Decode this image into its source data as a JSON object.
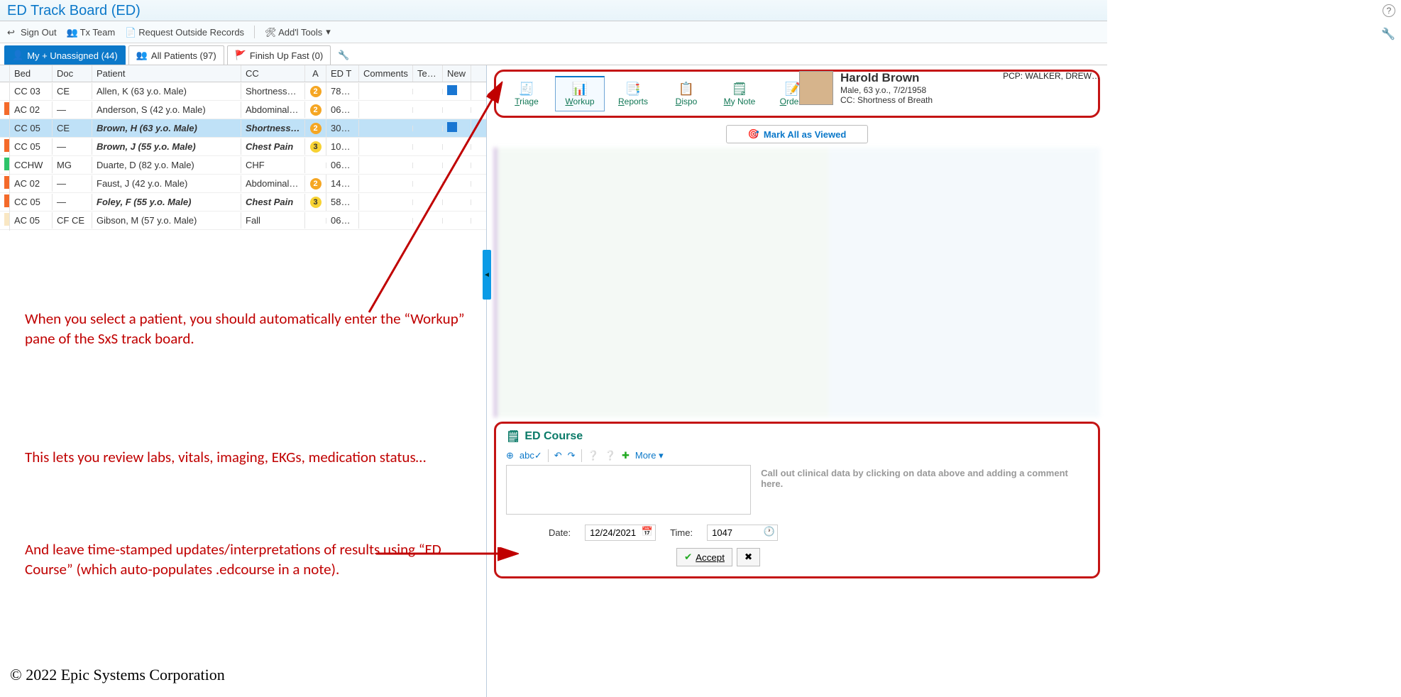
{
  "header": {
    "title": "ED Track Board (ED)"
  },
  "toolbar": {
    "sign_out": "Sign Out",
    "tx_team": "Tx Team",
    "req_outside": "Request Outside Records",
    "addl_tools": "Add'l Tools"
  },
  "tabs": {
    "my_unassigned": "My + Unassigned (44)",
    "all_patients": "All Patients (97)",
    "finish_fast": "Finish Up Fast (0)"
  },
  "grid": {
    "headers": {
      "bed": "Bed",
      "doc": "Doc",
      "patient": "Patient",
      "cc": "CC",
      "a": "A",
      "edt": "ED T",
      "comments": "Comments",
      "team": "Team",
      "new": "New"
    },
    "rows": [
      {
        "flag": "",
        "bed": "CC 03",
        "doc": "CE",
        "patient": "Allen, K (63 y.o. Male)",
        "cc": "Shortness…",
        "a": "2",
        "ab": "o",
        "edt": "78…",
        "new": "box",
        "bold": false,
        "sel": false
      },
      {
        "flag": "#f46a2a",
        "bed": "AC 02",
        "doc": "—",
        "patient": "Anderson, S (42 y.o. Male)",
        "cc": "Abdominal…",
        "a": "2",
        "ab": "o",
        "edt": "06…",
        "bold": false,
        "sel": false
      },
      {
        "flag": "",
        "bed": "CC 05",
        "doc": "CE",
        "patient": "Brown, H (63 y.o. Male)",
        "cc": "Shortness…",
        "a": "2",
        "ab": "o",
        "edt": "30…",
        "bold": true,
        "sel": true,
        "new": "box"
      },
      {
        "flag": "#f46a2a",
        "bed": "CC 05",
        "doc": "—",
        "patient": "Brown, J (55 y.o. Male)",
        "cc": "Chest Pain",
        "a": "3",
        "ab": "y",
        "edt": "10…",
        "bold": true,
        "sel": false
      },
      {
        "flag": "#2ec46a",
        "bed": "CCHW",
        "doc": "MG",
        "patient": "Duarte, D (82 y.o. Male)",
        "cc": "CHF",
        "a": "",
        "ab": "",
        "edt": "06…",
        "bold": false,
        "sel": false
      },
      {
        "flag": "#f46a2a",
        "bed": "AC 02",
        "doc": "—",
        "patient": "Faust, J (42 y.o. Male)",
        "cc": "Abdominal…",
        "a": "2",
        "ab": "o",
        "edt": "14…",
        "bold": false,
        "sel": false
      },
      {
        "flag": "#f46a2a",
        "bed": "CC 05",
        "doc": "—",
        "patient": "Foley, F (55 y.o. Male)",
        "cc": "Chest Pain",
        "a": "3",
        "ab": "y",
        "edt": "58…",
        "bold": true,
        "sel": false
      },
      {
        "flag": "#f9e7c3",
        "bed": "AC 05",
        "doc": "CF CE",
        "patient": "Gibson, M (57 y.o. Male)",
        "cc": "Fall",
        "a": "",
        "ab": "",
        "edt": "06…",
        "bold": false,
        "sel": false
      }
    ]
  },
  "chart_tabs": [
    {
      "label": "Triage",
      "icon": "🧾"
    },
    {
      "label": "Workup",
      "icon": "📊",
      "active": true
    },
    {
      "label": "Reports",
      "icon": "📑"
    },
    {
      "label": "Dispo",
      "icon": "📋"
    },
    {
      "label": "My Note",
      "icon": "🗒"
    },
    {
      "label": "Orders",
      "icon": "📝"
    }
  ],
  "patient": {
    "name": "Harold Brown",
    "line2": "Male, 63 y.o., 7/2/1958",
    "line3": "CC: Shortness of Breath",
    "pcp": "PCP: WALKER, DREW…"
  },
  "mark_viewed": "Mark All as Viewed",
  "edcourse": {
    "title": "ED Course",
    "more": "More",
    "hint": "Call out clinical data by clicking on data above and adding a comment here.",
    "date_label": "Date:",
    "date": "12/24/2021",
    "time_label": "Time:",
    "time": "1047",
    "accept": "Accept"
  },
  "annotations": {
    "a1": "When you select a patient, you should automatically enter the “Workup” pane of the SxS track board.",
    "a2": "This lets you review labs, vitals, imaging, EKGs, medication status…",
    "a3": "And leave time-stamped updates/interpretations of results using “ED Course” (which auto-populates .edcourse in a note)."
  },
  "copyright": "© 2022 Epic Systems Corporation"
}
